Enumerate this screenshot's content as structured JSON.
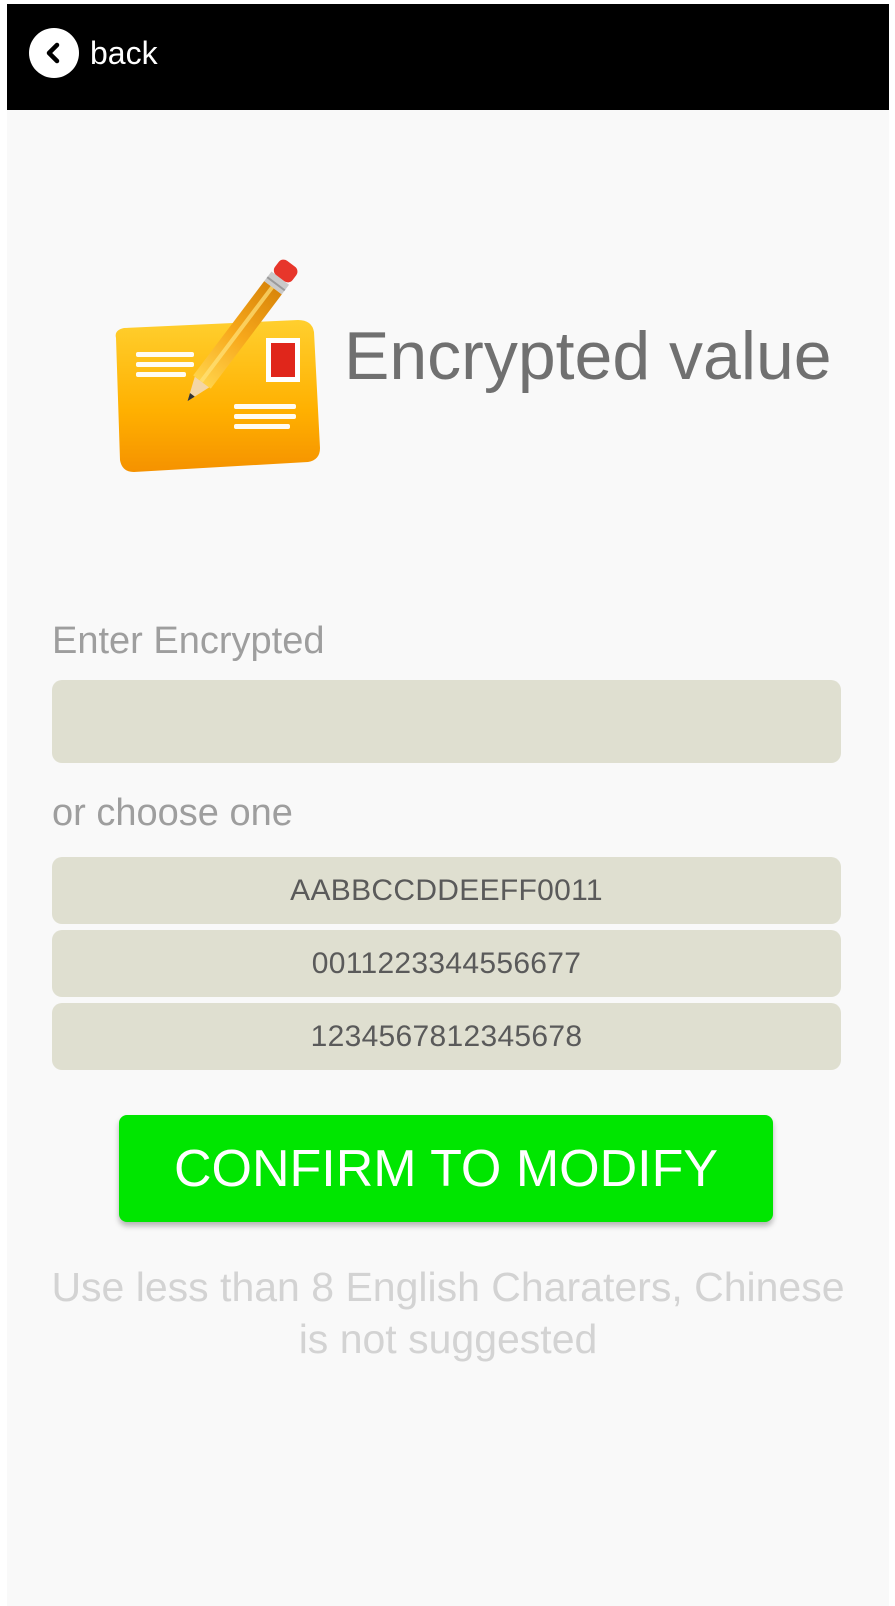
{
  "topbar": {
    "back_label": "back",
    "background": "#000000",
    "icon": "chevron-left-icon"
  },
  "hero": {
    "icon": "envelope-pencil-icon",
    "title": "Encrypted value"
  },
  "form": {
    "input_label": "Enter Encrypted",
    "input_value": "",
    "choose_label": "or choose one",
    "options": [
      "AABBCCDDEEFF0011",
      "0011223344556677",
      "1234567812345678"
    ],
    "field_color": "#dfdfd0"
  },
  "confirm": {
    "label": "CONFIRM TO MODIFY",
    "color": "#00e600"
  },
  "hint": {
    "line1": "Use less than 8 English Charaters, Chinese",
    "line2": "is not suggested"
  }
}
